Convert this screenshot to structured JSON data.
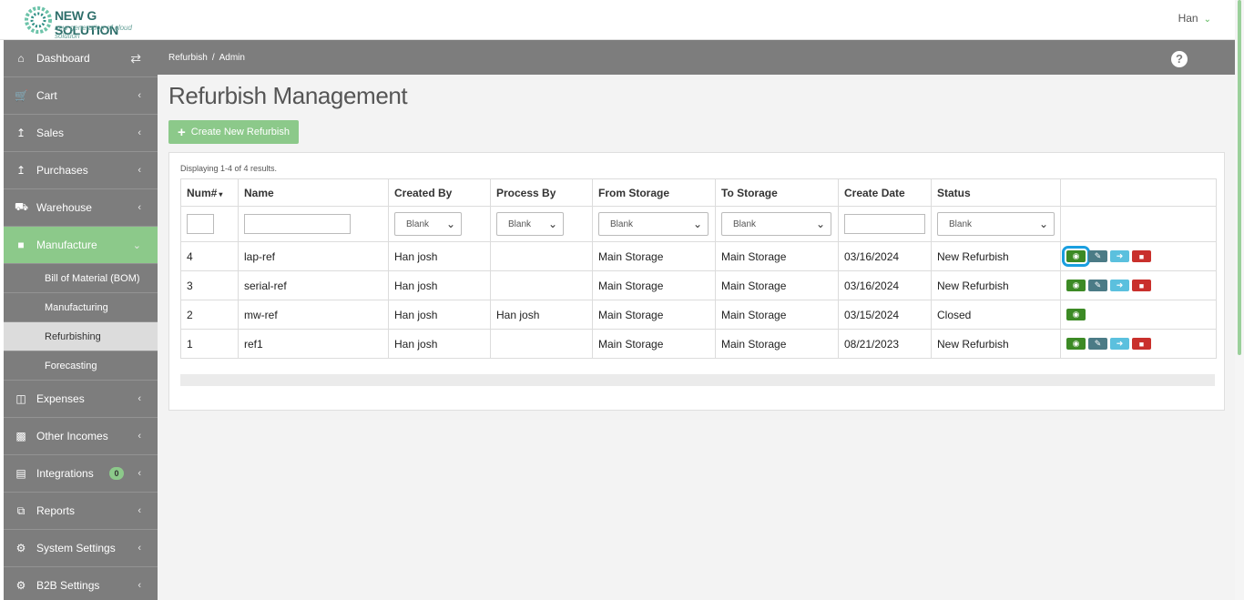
{
  "brand": {
    "title": "NEW G SOLUTION",
    "tagline": "new generation of cloud solution"
  },
  "user": {
    "name": "Han"
  },
  "sidebar": {
    "items": [
      {
        "label": "Dashboard",
        "icon": "home-icon"
      },
      {
        "label": "Cart",
        "icon": "cart-icon"
      },
      {
        "label": "Sales",
        "icon": "upload-icon"
      },
      {
        "label": "Purchases",
        "icon": "upload-icon"
      },
      {
        "label": "Warehouse",
        "icon": "truck-icon"
      },
      {
        "label": "Manufacture",
        "icon": "factory-icon"
      }
    ],
    "subitems": [
      {
        "label": "Bill of Material (BOM)"
      },
      {
        "label": "Manufacturing"
      },
      {
        "label": "Refurbishing"
      },
      {
        "label": "Forecasting"
      }
    ],
    "items2": [
      {
        "label": "Expenses",
        "icon": "file-icon"
      },
      {
        "label": "Other Incomes",
        "icon": "money-icon"
      },
      {
        "label": "Integrations",
        "icon": "plug-icon",
        "badge": "0"
      },
      {
        "label": "Reports",
        "icon": "copy-icon"
      },
      {
        "label": "System Settings",
        "icon": "gears-icon"
      },
      {
        "label": "B2B Settings",
        "icon": "gears-icon"
      }
    ]
  },
  "breadcrumb": {
    "first": "Refurbish",
    "second": "Admin"
  },
  "page": {
    "title": "Refurbish Management",
    "create_label": "Create New Refurbish",
    "summary": "Displaying 1-4 of 4 results."
  },
  "table": {
    "headers": [
      "Num#",
      "Name",
      "Created By",
      "Process By",
      "From Storage",
      "To Storage",
      "Create Date",
      "Status"
    ],
    "filter_select": "Blank",
    "rows": [
      {
        "num": "4",
        "name": "lap-ref",
        "created_by": "Han josh",
        "process_by": "",
        "from": "Main Storage",
        "to": "Main Storage",
        "date": "03/16/2024",
        "status": "New Refurbish"
      },
      {
        "num": "3",
        "name": "serial-ref",
        "created_by": "Han josh",
        "process_by": "",
        "from": "Main Storage",
        "to": "Main Storage",
        "date": "03/16/2024",
        "status": "New Refurbish"
      },
      {
        "num": "2",
        "name": "mw-ref",
        "created_by": "Han josh",
        "process_by": "Han josh",
        "from": "Main Storage",
        "to": "Main Storage",
        "date": "03/15/2024",
        "status": "Closed"
      },
      {
        "num": "1",
        "name": "ref1",
        "created_by": "Han josh",
        "process_by": "",
        "from": "Main Storage",
        "to": "Main Storage",
        "date": "08/21/2023",
        "status": "New Refurbish"
      }
    ]
  },
  "colors": {
    "accent": "#8cc98a",
    "sidebar": "#7d7d7d",
    "view": "#3c8a25",
    "edit": "#4b7b86",
    "go": "#5bc0de",
    "delete": "#c9302c"
  }
}
